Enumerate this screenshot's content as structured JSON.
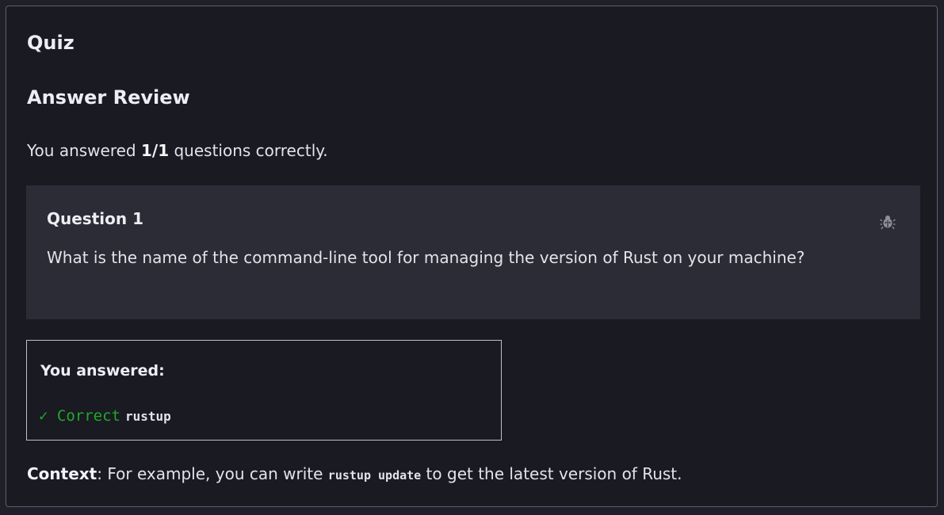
{
  "quiz": {
    "title": "Quiz",
    "review_title": "Answer Review",
    "summary": {
      "prefix": "You answered ",
      "score": "1/1",
      "suffix": " questions correctly."
    },
    "question": {
      "label": "Question 1",
      "text": "What is the name of the command-line tool for managing the version of Rust on your machine?",
      "report_icon": "bug-icon"
    },
    "answer": {
      "heading": "You answered:",
      "status": "✓ Correct",
      "value": "rustup"
    },
    "context": {
      "label": "Context",
      "text_before": ": For example, you can write ",
      "code": "rustup update",
      "text_after": " to get the latest version of Rust."
    }
  },
  "colors": {
    "background": "#191a22",
    "card": "#2b2c35",
    "correct": "#22a82a",
    "border": "#5c5f6a"
  }
}
